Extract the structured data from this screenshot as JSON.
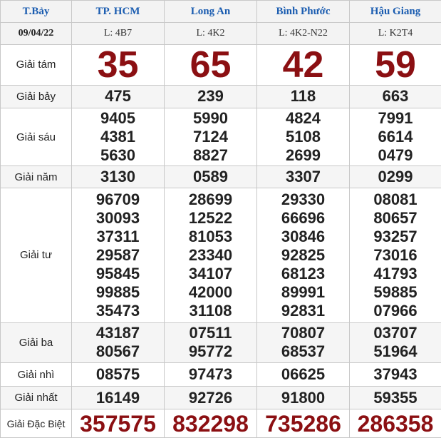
{
  "header": {
    "day": "T.Bảy",
    "date": "09/04/22",
    "provinces": [
      {
        "name": "TP. HCM",
        "code": "L: 4B7"
      },
      {
        "name": "Long An",
        "code": "L: 4K2"
      },
      {
        "name": "Bình Phước",
        "code": "L: 4K2-N22"
      },
      {
        "name": "Hậu Giang",
        "code": "L: K2T4"
      }
    ]
  },
  "prizes": [
    {
      "label": "Giải tám",
      "values": [
        [
          "35"
        ],
        [
          "65"
        ],
        [
          "42"
        ],
        [
          "59"
        ]
      ]
    },
    {
      "label": "Giải bảy",
      "values": [
        [
          "475"
        ],
        [
          "239"
        ],
        [
          "118"
        ],
        [
          "663"
        ]
      ]
    },
    {
      "label": "Giải sáu",
      "values": [
        [
          "9405",
          "4381",
          "5630"
        ],
        [
          "5990",
          "7124",
          "8827"
        ],
        [
          "4824",
          "5108",
          "2699"
        ],
        [
          "7991",
          "6614",
          "0479"
        ]
      ]
    },
    {
      "label": "Giải năm",
      "values": [
        [
          "3130"
        ],
        [
          "0589"
        ],
        [
          "3307"
        ],
        [
          "0299"
        ]
      ]
    },
    {
      "label": "Giải tư",
      "values": [
        [
          "96709",
          "30093",
          "37311",
          "29587",
          "95845",
          "99885",
          "35473"
        ],
        [
          "28699",
          "12522",
          "81053",
          "23340",
          "34107",
          "42000",
          "31108"
        ],
        [
          "29330",
          "66696",
          "30846",
          "92825",
          "68123",
          "89991",
          "92831"
        ],
        [
          "08081",
          "80657",
          "93257",
          "73016",
          "41793",
          "59885",
          "07966"
        ]
      ]
    },
    {
      "label": "Giải ba",
      "values": [
        [
          "43187",
          "80567"
        ],
        [
          "07511",
          "95772"
        ],
        [
          "70807",
          "68537"
        ],
        [
          "03707",
          "51964"
        ]
      ]
    },
    {
      "label": "Giải nhì",
      "values": [
        [
          "08575"
        ],
        [
          "97473"
        ],
        [
          "06625"
        ],
        [
          "37943"
        ]
      ]
    },
    {
      "label": "Giải nhất",
      "values": [
        [
          "16149"
        ],
        [
          "92726"
        ],
        [
          "91800"
        ],
        [
          "59355"
        ]
      ]
    },
    {
      "label": "Giải Đặc Biệt",
      "values": [
        [
          "357575"
        ],
        [
          "832298"
        ],
        [
          "735286"
        ],
        [
          "286358"
        ]
      ]
    }
  ],
  "colors": {
    "accent_blue": "#1a5cb0",
    "prize_red": "#8b0f12",
    "header_bg": "#f3f3f3",
    "border": "#c8c8c8"
  }
}
